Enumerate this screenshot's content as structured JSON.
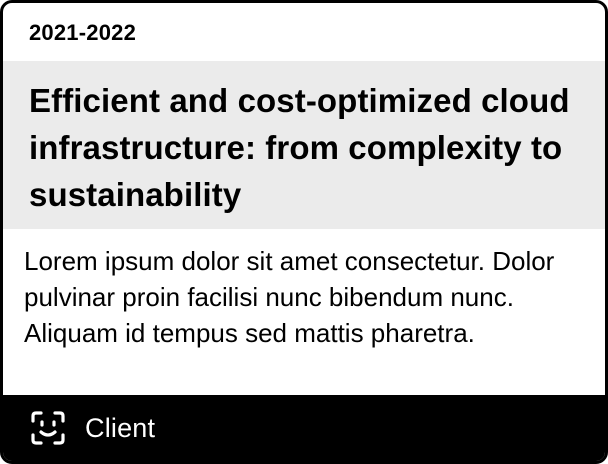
{
  "card": {
    "year": "2021-2022",
    "title": "Efficient and cost-optimized cloud infrastructure: from complexity to sustainability",
    "description": "Lorem ipsum dolor sit amet consectetur. Dolor pulvinar proin facilisi nunc bibendum nunc. Aliquam id tempus sed mattis pharetra.",
    "footer": {
      "icon": "face-scan-icon",
      "label": "Client"
    }
  },
  "colors": {
    "border": "#000000",
    "title_band": "#ebebeb",
    "footer_bg": "#000000",
    "footer_text": "#ffffff"
  }
}
